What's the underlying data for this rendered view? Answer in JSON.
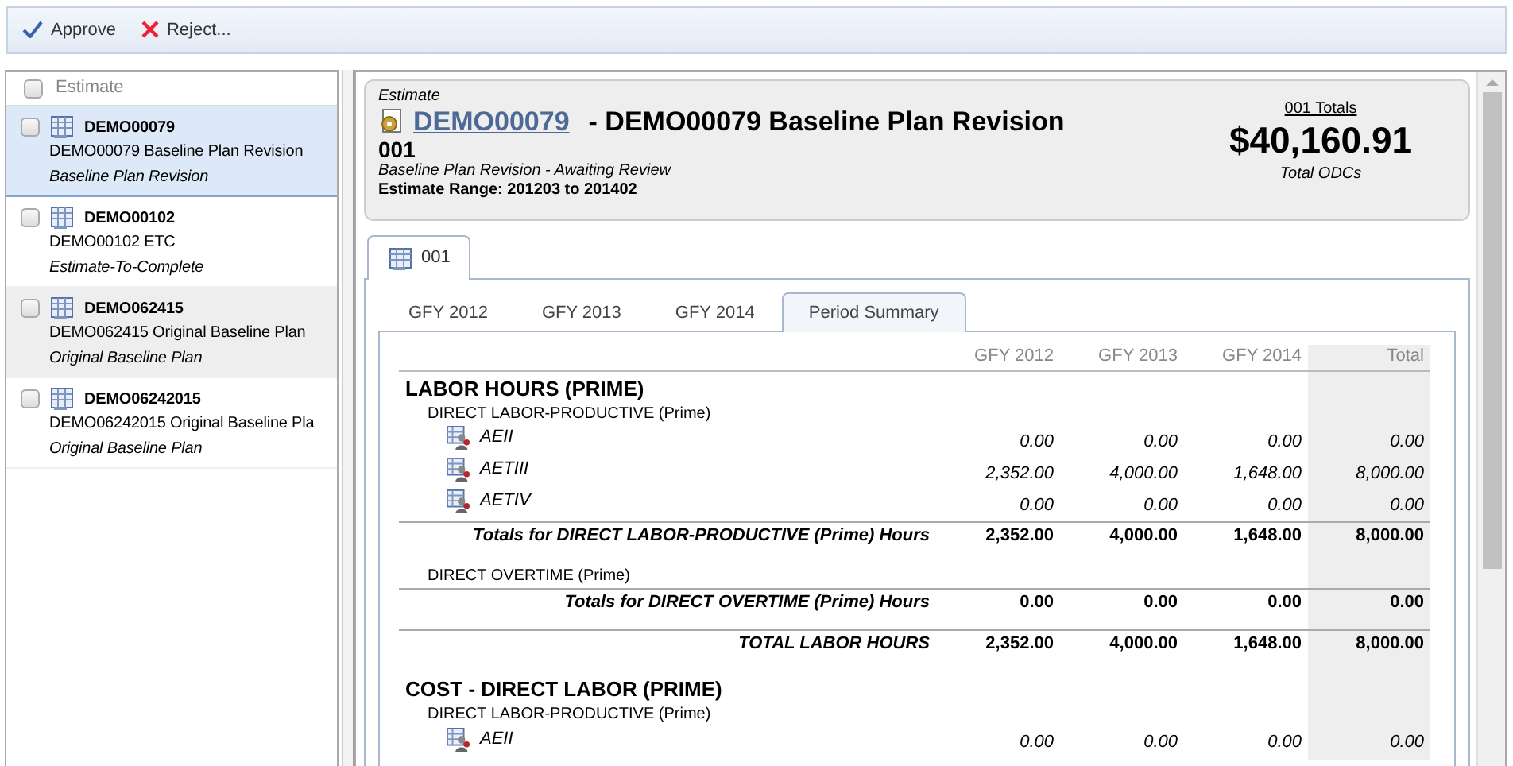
{
  "toolbar": [
    {
      "kind": "approve",
      "label": "Approve"
    },
    {
      "kind": "reject",
      "label": "Reject..."
    }
  ],
  "estimate_list": {
    "header": "Estimate",
    "header_checked": false,
    "items": [
      {
        "code": "DEMO00079",
        "description": "DEMO00079 Baseline Plan Revision",
        "type": "Baseline Plan Revision",
        "checked": false,
        "selected": true
      },
      {
        "code": "DEMO00102",
        "description": "DEMO00102 ETC",
        "type": "Estimate-To-Complete",
        "checked": false,
        "selected": false
      },
      {
        "code": "DEMO062415",
        "description": "DEMO062415 Original Baseline Plan",
        "type": "Original Baseline Plan",
        "checked": false,
        "selected": false
      },
      {
        "code": "DEMO06242015",
        "description": "DEMO06242015 Original Baseline Pla",
        "type": "Original Baseline Plan",
        "checked": false,
        "selected": false
      }
    ]
  },
  "header": {
    "caption": "Estimate",
    "link": "DEMO00079",
    "title": "- DEMO00079 Baseline Plan Revision",
    "number": "001",
    "status": "Baseline Plan Revision - Awaiting Review",
    "range": "Estimate Range: 201203 to 201402",
    "totals_link": "001 Totals",
    "amount": "$40,160.91",
    "amount_label": "Total ODCs"
  },
  "outer_tabs": [
    {
      "label": "001",
      "selected": true
    }
  ],
  "period_tabs": [
    {
      "label": "GFY 2012",
      "selected": false
    },
    {
      "label": "GFY 2013",
      "selected": false
    },
    {
      "label": "GFY 2014",
      "selected": false
    },
    {
      "label": "Period Summary",
      "selected": true
    }
  ],
  "table": {
    "columns": [
      "GFY 2012",
      "GFY 2013",
      "GFY 2014",
      "Total"
    ],
    "rows": [
      {
        "kind": "section",
        "label": "LABOR HOURS (PRIME)"
      },
      {
        "kind": "group",
        "label": "DIRECT LABOR-PRODUCTIVE (Prime)"
      },
      {
        "kind": "item",
        "label": "AEII",
        "values": [
          "0.00",
          "0.00",
          "0.00",
          "0.00"
        ]
      },
      {
        "kind": "item",
        "label": "AETIII",
        "values": [
          "2,352.00",
          "4,000.00",
          "1,648.00",
          "8,000.00"
        ]
      },
      {
        "kind": "item",
        "label": "AETIV",
        "values": [
          "0.00",
          "0.00",
          "0.00",
          "0.00"
        ]
      },
      {
        "kind": "total",
        "label": "Totals for DIRECT LABOR-PRODUCTIVE (Prime) Hours",
        "values": [
          "2,352.00",
          "4,000.00",
          "1,648.00",
          "8,000.00"
        ]
      },
      {
        "kind": "group",
        "label": "DIRECT OVERTIME (Prime)"
      },
      {
        "kind": "total",
        "label": "Totals for DIRECT OVERTIME (Prime) Hours",
        "values": [
          "0.00",
          "0.00",
          "0.00",
          "0.00"
        ]
      },
      {
        "kind": "total",
        "label": "TOTAL LABOR HOURS",
        "values": [
          "2,352.00",
          "4,000.00",
          "1,648.00",
          "8,000.00"
        ]
      },
      {
        "kind": "section",
        "label": "COST - DIRECT LABOR (PRIME)"
      },
      {
        "kind": "group",
        "label": "DIRECT LABOR-PRODUCTIVE (Prime)"
      },
      {
        "kind": "item",
        "label": "AEII",
        "values": [
          "0.00",
          "0.00",
          "0.00",
          "0.00"
        ]
      }
    ]
  }
}
